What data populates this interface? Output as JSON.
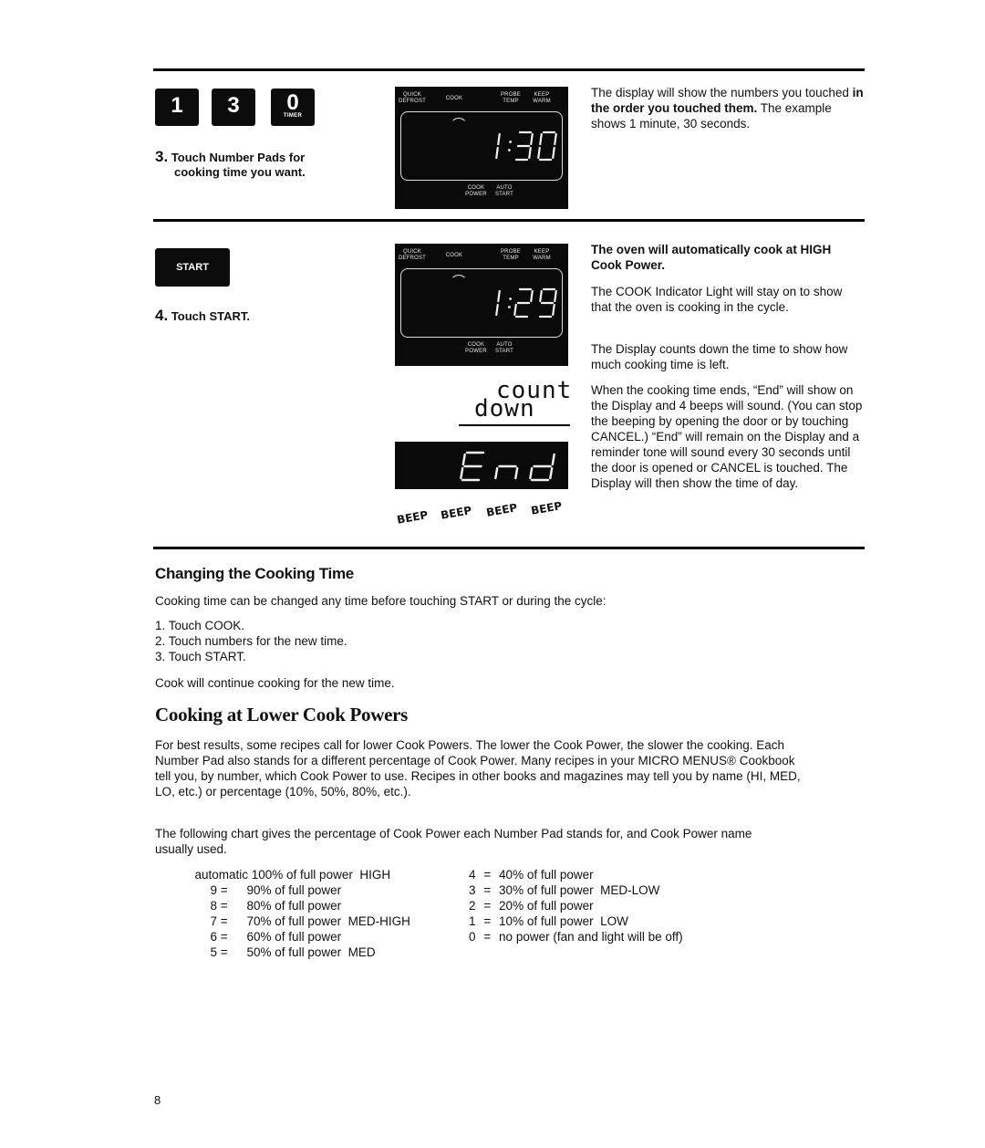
{
  "step3": {
    "pads": [
      {
        "label": "1",
        "sub": ""
      },
      {
        "label": "3",
        "sub": ""
      },
      {
        "label": "0",
        "sub": "TIMER"
      }
    ],
    "number": "3.",
    "text_line1": "Touch Number Pads for",
    "text_line2": "cooking time you want.",
    "display": {
      "labels": {
        "quick_defrost": [
          "QUICK",
          "DEFROST"
        ],
        "cook": "COOK",
        "probe_temp": [
          "PROBE",
          "TEMP"
        ],
        "keep_warm": [
          "KEEP",
          "WARM"
        ],
        "cook_power": [
          "COOK",
          "POWER"
        ],
        "auto_start": [
          "AUTO",
          "START"
        ]
      },
      "readout": "1:30"
    },
    "description": {
      "part1": "The display will show the numbers you touched ",
      "bold": "in the order you touched them.",
      "part2": " The example shows 1 minute, 30 seconds."
    }
  },
  "step4": {
    "button_label": "START",
    "number": "4.",
    "text": "Touch START.",
    "display": {
      "labels": {
        "quick_defrost": [
          "QUICK",
          "DEFROST"
        ],
        "cook": "COOK",
        "probe_temp": [
          "PROBE",
          "TEMP"
        ],
        "keep_warm": [
          "KEEP",
          "WARM"
        ],
        "cook_power": [
          "COOK",
          "POWER"
        ],
        "auto_start": [
          "AUTO",
          "START"
        ]
      },
      "readout": "1:29"
    },
    "countdown_line1": "count",
    "countdown_line2": "down",
    "end_readout": "End",
    "beeps": [
      "BEEP",
      "BEEP",
      "BEEP",
      "BEEP"
    ],
    "bold_note": "The oven will automatically cook at HIGH Cook Power.",
    "para1": "The COOK Indicator Light will stay on to show that the oven is cooking in the cycle.",
    "para2": "The Display counts down the time to show how much cooking time is left.",
    "para3": "When the cooking time ends, “End” will show on the Display and 4 beeps will sound. (You can stop the beeping by opening the door or by touching CANCEL.) “End” will remain on the Display and a reminder tone will sound every 30 seconds until the door is opened or CANCEL is touched. The Display will then show the time of day."
  },
  "changing": {
    "heading": "Changing the Cooking Time",
    "intro": "Cooking time can be changed any time before touching START or during the cycle:",
    "steps": [
      "1. Touch COOK.",
      "2. Touch numbers for the new time.",
      "3. Touch START."
    ],
    "outro": "Cook will continue cooking for the new time."
  },
  "lower": {
    "heading": "Cooking at Lower Cook Powers",
    "para1": "For best results, some recipes call for lower Cook Powers. The lower the Cook Power, the slower the cooking. Each Number Pad also stands for a different percentage of Cook Power. Many recipes in your MICRO MENUS® Cookbook tell you, by number, which Cook Power to use. Recipes in other books and magazines may tell you by name (HI, MED, LO, etc.) or percentage (10%, 50%, 80%, etc.).",
    "para2": "The following chart gives the percentage of Cook Power each Number Pad stands for, and Cook Power name usually used.",
    "table_left": [
      {
        "pad": "automatic",
        "eq": "",
        "desc": "100% of full power",
        "name": "HIGH"
      },
      {
        "pad": "9",
        "eq": "=",
        "desc": "90% of full power",
        "name": ""
      },
      {
        "pad": "8",
        "eq": "=",
        "desc": "80% of full power",
        "name": ""
      },
      {
        "pad": "7",
        "eq": "=",
        "desc": "70% of full power",
        "name": "MED-HIGH"
      },
      {
        "pad": "6",
        "eq": "=",
        "desc": "60% of full power",
        "name": ""
      },
      {
        "pad": "5",
        "eq": "=",
        "desc": "50% of full power",
        "name": "MED"
      }
    ],
    "table_right": [
      {
        "pad": "4",
        "eq": "=",
        "desc": "40% of full power",
        "name": ""
      },
      {
        "pad": "3",
        "eq": "=",
        "desc": "30% of full power",
        "name": "MED-LOW"
      },
      {
        "pad": "2",
        "eq": "=",
        "desc": "20% of full power",
        "name": ""
      },
      {
        "pad": "1",
        "eq": "=",
        "desc": "10% of full power",
        "name": "LOW"
      },
      {
        "pad": "0",
        "eq": "=",
        "desc": "no power (fan and light will be off)",
        "name": ""
      }
    ]
  },
  "page_number": "8"
}
